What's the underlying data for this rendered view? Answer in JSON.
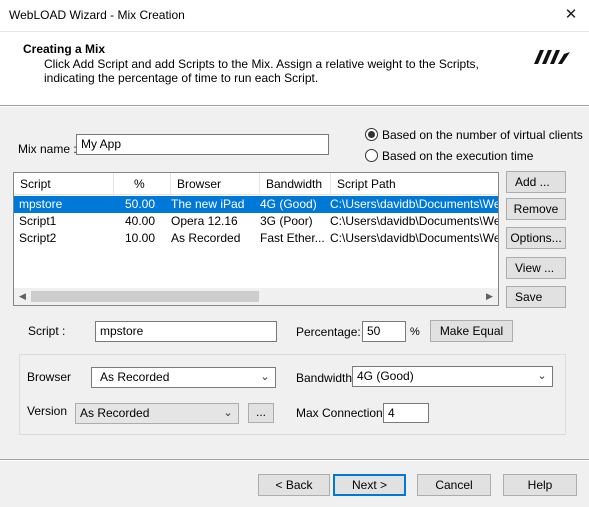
{
  "window": {
    "title": "WebLOAD Wizard - Mix Creation",
    "close_glyph": "✕"
  },
  "header": {
    "title": "Creating a Mix",
    "description": "Click Add Script and add Scripts to the Mix. Assign a relative weight to the Scripts, indicating the percentage of time to run each Script."
  },
  "mix": {
    "label": "Mix name :",
    "value": "My App"
  },
  "mode": {
    "virtual_clients": "Based on the number of virtual clients",
    "execution_time": "Based on the execution time",
    "selected": "virtual_clients"
  },
  "table": {
    "columns": [
      "Script",
      "%",
      "Browser",
      "Bandwidth",
      "Script Path"
    ],
    "rows": [
      {
        "script": "mpstore",
        "percent": "50.00",
        "browser": "The new iPad",
        "bandwidth": "4G (Good)",
        "path": "C:\\Users\\davidb\\Documents\\WebLO",
        "selected": true
      },
      {
        "script": "Script1",
        "percent": "40.00",
        "browser": "Opera 12.16",
        "bandwidth": "3G (Poor)",
        "path": "C:\\Users\\davidb\\Documents\\WebLO",
        "selected": false
      },
      {
        "script": "Script2",
        "percent": "10.00",
        "browser": "As Recorded",
        "bandwidth": "Fast Ether...",
        "path": "C:\\Users\\davidb\\Documents\\WebLO",
        "selected": false
      }
    ]
  },
  "side_buttons": {
    "add": "Add ...",
    "remove": "Remove",
    "options": "Options...",
    "view": "View ...",
    "save": "Save"
  },
  "script_detail": {
    "label": "Script :",
    "value": "mpstore"
  },
  "percentage": {
    "label": "Percentage:",
    "value": "50",
    "unit": "%",
    "make_equal": "Make Equal"
  },
  "browser": {
    "label": "Browser",
    "value": "As Recorded"
  },
  "bandwidth": {
    "label": "Bandwidth",
    "value": "4G (Good)"
  },
  "version": {
    "label": "Version",
    "value": "As Recorded",
    "more": "..."
  },
  "max_connections": {
    "label": "Max Connections",
    "value": "4"
  },
  "footer": {
    "back": "< Back",
    "next": "Next >",
    "cancel": "Cancel",
    "help": "Help"
  },
  "colors": {
    "selection": "#0078d7",
    "accent_border": "#0078d7"
  }
}
